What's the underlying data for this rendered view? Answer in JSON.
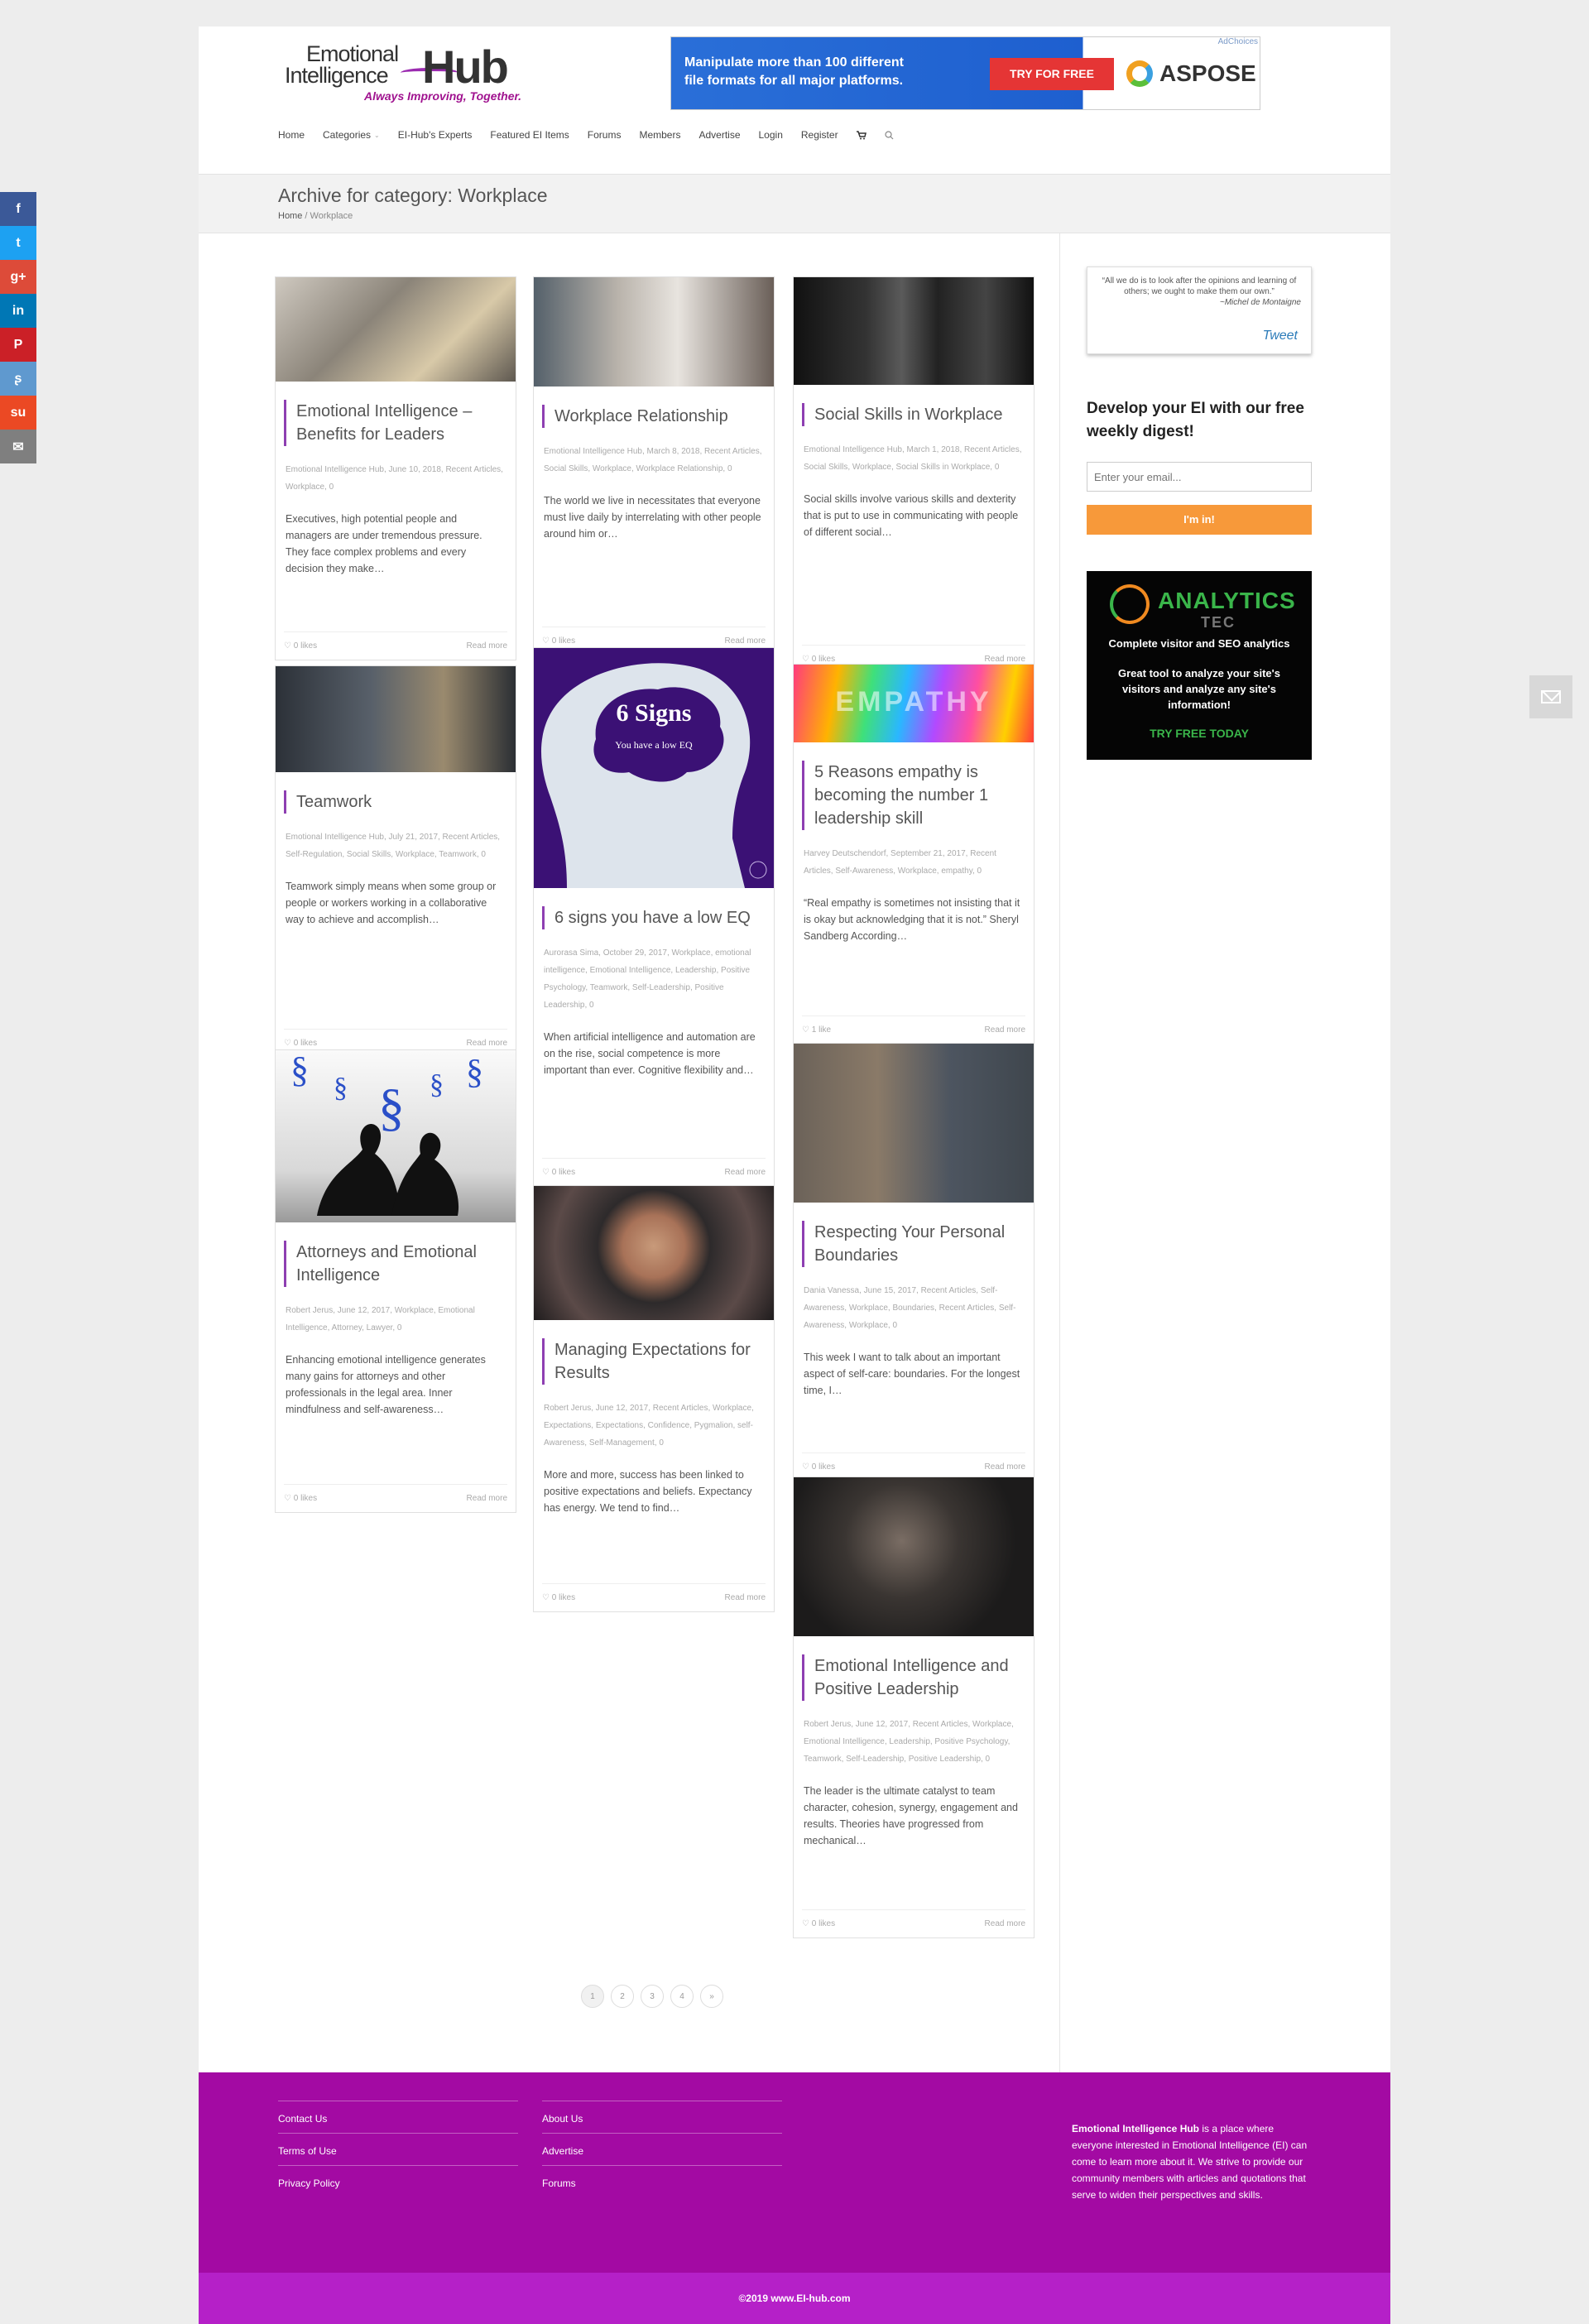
{
  "header": {
    "logo": {
      "line1": "Emotional",
      "line2": "Intelligence",
      "hub": "Hub",
      "tagline": "Always Improving, Together."
    },
    "ad": {
      "text": "Manipulate more than 100 different file formats for all major platforms.",
      "button": "TRY FOR FREE",
      "brand": "ASPOSE",
      "choices": "AdChoices"
    }
  },
  "nav": [
    "Home",
    "Categories",
    "EI-Hub's Experts",
    "Featured EI Items",
    "Forums",
    "Members",
    "Advertise",
    "Login",
    "Register"
  ],
  "title": "Archive for category: Workplace",
  "breadcrumb": {
    "home": "Home",
    "current": "Workplace"
  },
  "posts": [
    {
      "title": "Emotional Intelligence – Benefits for Leaders",
      "meta": "Emotional Intelligence Hub, June 10, 2018, Recent Articles, Workplace, 0",
      "excerpt": "Executives, high potential people and managers are under tremendous pressure. They face complex problems and every decision they make…",
      "likes": "0 likes",
      "more": "Read more",
      "image": "office-photo"
    },
    {
      "title": "Workplace Relationship",
      "meta": "Emotional Intelligence Hub, March 8, 2018, Recent Articles, Social Skills, Workplace, Workplace Relationship, 0",
      "excerpt": "The world we live in necessitates that everyone must live daily by interrelating with other people around him or…",
      "likes": "0 likes",
      "more": "Read more",
      "image": "meeting-photo"
    },
    {
      "title": "Social Skills in Workplace",
      "meta": "Emotional Intelligence Hub, March 1, 2018, Recent Articles, Social Skills, Workplace, Social Skills in Workplace, 0",
      "excerpt": "Social skills involve various skills and dexterity that is put to use in communicating with people of different social…",
      "likes": "0 likes",
      "more": "Read more",
      "image": "screens-photo"
    },
    {
      "title": "Teamwork",
      "meta": "Emotional Intelligence Hub, July 21, 2017, Recent Articles, Self-Regulation, Social Skills, Workplace, Teamwork, 0",
      "excerpt": "Teamwork simply means when some group or people or workers working in a collaborative way to achieve and accomplish…",
      "likes": "0 likes",
      "more": "Read more",
      "image": "teamwork-photo"
    },
    {
      "title": "6 signs you have a low EQ",
      "meta": "Aurorasa Sima, October 29, 2017, Workplace, emotional intelligence, Emotional Intelligence, Leadership, Positive Psychology, Teamwork, Self-Leadership, Positive Leadership, 0",
      "excerpt": "When artificial intelligence and automation are on the rise, social competence is more important than ever. Cognitive flexibility and…",
      "likes": "0 likes",
      "more": "Read more",
      "image": "6signs",
      "img_title": "6 Signs",
      "img_sub": "You have a low EQ"
    },
    {
      "title": "5 Reasons empathy is becoming the number 1 leadership skill",
      "meta": "Harvey Deutschendorf, September 21, 2017, Recent Articles, Self-Awareness, Workplace, empathy, 0",
      "excerpt": "“Real empathy is sometimes not insisting that it is okay but acknowledging that it is not.” Sheryl Sandberg According…",
      "likes": "1 like",
      "more": "Read more",
      "image": "empathy",
      "img_title": "EMPATHY"
    },
    {
      "title": "Attorneys and Emotional Intelligence",
      "meta": "Robert Jerus, June 12, 2017, Workplace, Emotional Intelligence, Attorney, Lawyer, 0",
      "excerpt": "Enhancing emotional intelligence generates many gains for attorneys and other professionals in the legal area. Inner mindfulness and self-awareness…",
      "likes": "0 likes",
      "more": "Read more",
      "image": "attorneys"
    },
    {
      "title": "Managing Expectations for Results",
      "meta": "Robert Jerus, June 12, 2017, Recent Articles, Workplace, Expectations, Expectations, Confidence, Pygmalion, self-Awareness, Self-Management, 0",
      "excerpt": "More and more, success has been linked to positive expectations and beliefs. Expectancy has energy. We tend to find…",
      "likes": "0 likes",
      "more": "Read more",
      "image": "smile-photo"
    },
    {
      "title": "Respecting Your Personal Boundaries",
      "meta": "Dania Vanessa, June 15, 2017, Recent Articles, Self-Awareness, Workplace, Boundaries, Recent Articles, Self-Awareness, Workplace, 0",
      "excerpt": "This week I want to talk about an important aspect of self-care: boundaries.   For the longest time, I…",
      "likes": "0 likes",
      "more": "Read more",
      "image": "couple-photo"
    },
    {
      "title": "Emotional Intelligence and Positive Leadership",
      "meta": "Robert Jerus, June 12, 2017, Recent Articles, Workplace, Emotional Intelligence, Leadership, Positive Psychology, Teamwork, Self-Leadership, Positive Leadership, 0",
      "excerpt": "The leader is the ultimate catalyst to team character, cohesion, synergy, engagement and results. Theories have progressed from mechanical…",
      "likes": "0 likes",
      "more": "Read more",
      "image": "suit-photo"
    }
  ],
  "pagination": [
    "1",
    "2",
    "3",
    "4",
    "»"
  ],
  "sidebar": {
    "quote": "“All we do is to look after the opinions and learning of others; we ought to make them our own.”",
    "quote_by": "~Michel de Montaigne",
    "tweet": "Tweet",
    "digest_title": "Develop your EI with our free weekly digest!",
    "email_placeholder": "Enter your email...",
    "button": "I'm in!",
    "ad": {
      "brand": "ANALYTICS",
      "brand2": "TEC",
      "line1": "Complete visitor and SEO analytics",
      "line2": "Great tool to analyze your site's visitors and analyze any site's information!",
      "cta": "TRY FREE TODAY"
    }
  },
  "footer": {
    "col1": [
      "Contact Us",
      "Terms of Use",
      "Privacy Policy"
    ],
    "col2": [
      "About Us",
      "Advertise",
      "Forums"
    ],
    "about_bold": "Emotional Intelligence Hub",
    "about": " is a place where everyone interested in Emotional Intelligence (EI) can come to learn more about it. We strive to provide our community members with articles and quotations that serve to widen their perspectives and skills.",
    "copyright": "©2019 www.EI-hub.com"
  },
  "share": [
    "f",
    "t",
    "g+",
    "in",
    "P",
    "su",
    "ʂ",
    "✉"
  ],
  "colors": {
    "accent": "#8e3fb2",
    "footer": "#a30aa3",
    "button": "#f7993a"
  }
}
